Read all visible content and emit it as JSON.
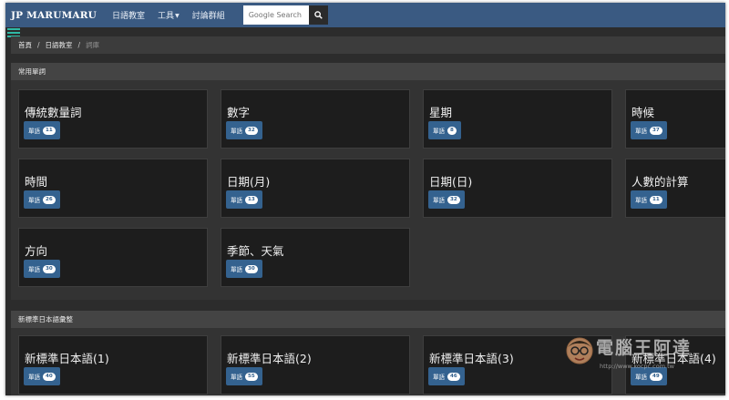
{
  "navbar": {
    "brand": "JP MARUMARU",
    "links": [
      "日語教室",
      "工具",
      "討論群組"
    ],
    "search_placeholder": "Google Search"
  },
  "breadcrumb": [
    "首頁",
    "日語教室",
    "詞庫"
  ],
  "sections": [
    {
      "title": "常用單詞",
      "cards": [
        {
          "title": "傳統數量詞",
          "button": "單語",
          "count": "11"
        },
        {
          "title": "數字",
          "button": "單語",
          "count": "32"
        },
        {
          "title": "星期",
          "button": "單語",
          "count": "8"
        },
        {
          "title": "時候",
          "button": "單語",
          "count": "37"
        },
        {
          "title": "時間",
          "button": "單語",
          "count": "26"
        },
        {
          "title": "日期(月)",
          "button": "單語",
          "count": "13"
        },
        {
          "title": "日期(日)",
          "button": "單語",
          "count": "32"
        },
        {
          "title": "人數的計算",
          "button": "單語",
          "count": "11"
        },
        {
          "title": "方向",
          "button": "單語",
          "count": "30"
        },
        {
          "title": "季節、天氣",
          "button": "單語",
          "count": "30"
        }
      ]
    },
    {
      "title": "新標準日本語彙整",
      "cards": [
        {
          "title": "新標準日本語(1)",
          "button": "單語",
          "count": "40"
        },
        {
          "title": "新標準日本語(2)",
          "button": "單語",
          "count": "55"
        },
        {
          "title": "新標準日本語(3)",
          "button": "單語",
          "count": "46"
        },
        {
          "title": "新標準日本語(4)",
          "button": "單語",
          "count": "49"
        }
      ]
    }
  ],
  "watermark": {
    "text": "電腦王阿達",
    "url": "http://www.kocpc.com.tw"
  },
  "colors": {
    "navbar": "#3a5a82",
    "button": "#34628f",
    "hamburger": "#2fb9a5"
  }
}
